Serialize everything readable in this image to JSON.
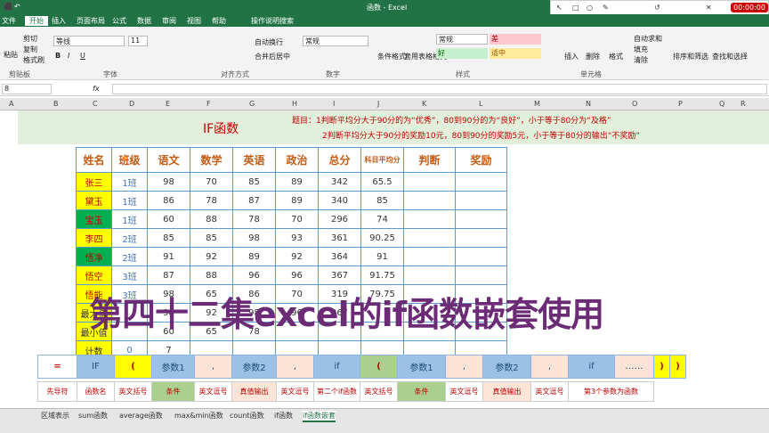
{
  "title": "函数 - Excel",
  "tabs": [
    "文件",
    "开始",
    "插入",
    "页面布局",
    "公式",
    "数据",
    "审阅",
    "视图",
    "帮助",
    "操作说明搜索"
  ],
  "groups": {
    "clipboard": "剪贴板",
    "font": "字体",
    "align": "对齐方式",
    "number": "数字",
    "styles": "样式",
    "cells": "单元格",
    "paste": "粘贴"
  },
  "font_name": "等线",
  "font_size": "11",
  "num_fmt": "常规",
  "btns": {
    "cut": "剪切",
    "copy": "复制",
    "painter": "格式刷",
    "wrap": "自动换行",
    "merge": "合并后居中",
    "cond": "条件格式",
    "table": "套用表格格式",
    "insert": "插入",
    "delete": "删除",
    "format": "格式",
    "autosum": "自动求和",
    "fill": "填充",
    "clear": "清除",
    "sort": "排序和筛选",
    "find": "查找和选择"
  },
  "styles_cells": [
    "常规",
    "差",
    "好",
    "适中"
  ],
  "cell_ref": "8",
  "fx": "fx",
  "timer": "00:00:00",
  "cols": [
    "A",
    "B",
    "C",
    "D",
    "E",
    "F",
    "G",
    "H",
    "I",
    "J",
    "K",
    "L",
    "M",
    "N",
    "O",
    "P",
    "Q",
    "R"
  ],
  "banner": {
    "func": "IF函数",
    "q1": "题目：1判断平均分大于90分的为“优秀”，80到90分的为“良好”，小于等于80分为“及格”",
    "q2": "2判断平均分大于90分的奖励10元，80到90分的奖励5元，小于等于80分的输出“不奖励”"
  },
  "headers": [
    "姓名",
    "班级",
    "语文",
    "数学",
    "英语",
    "政治",
    "总分",
    "科目平均分",
    "判断",
    "奖励"
  ],
  "rows": [
    [
      "张三",
      "1班",
      "98",
      "70",
      "85",
      "89",
      "342",
      "65.5"
    ],
    [
      "黛玉",
      "1班",
      "86",
      "78",
      "87",
      "89",
      "340",
      "85"
    ],
    [
      "宝玉",
      "1班",
      "60",
      "88",
      "78",
      "70",
      "296",
      "74"
    ],
    [
      "李四",
      "2班",
      "85",
      "85",
      "98",
      "93",
      "361",
      "90.25"
    ],
    [
      "悟净",
      "2班",
      "91",
      "92",
      "89",
      "92",
      "364",
      "91"
    ],
    [
      "悟空",
      "3班",
      "87",
      "88",
      "96",
      "96",
      "367",
      "91.75"
    ],
    [
      "悟能",
      "3班",
      "98",
      "65",
      "86",
      "70",
      "319",
      "79.75"
    ],
    [
      "最大值",
      "",
      "98",
      "92",
      "98",
      "96",
      "367",
      ""
    ],
    [
      "最小值",
      "",
      "60",
      "65",
      "78",
      "",
      "",
      ""
    ],
    [
      "计数",
      "0",
      "7",
      "",
      "",
      "",
      "",
      ""
    ]
  ],
  "overlay": "第四十二集excel的if函数嵌套使用",
  "formula": [
    "=",
    "IF",
    "(",
    "参数1",
    ",",
    "参数2",
    ",",
    "if",
    "(",
    "参数1",
    ",",
    "参数2",
    ",",
    "if",
    "……",
    ")",
    ")"
  ],
  "legend": [
    "先导符",
    "函数名",
    "英文括号",
    "条件",
    "英文逗号",
    "真值输出",
    "英文逗号",
    "第二个if函数",
    "英文括号",
    "条件",
    "英文逗号",
    "真值输出",
    "英文逗号",
    "第3个参数为函数"
  ],
  "sheets": [
    "区域表示",
    "sum函数",
    "average函数",
    "max&min函数",
    "count函数",
    "if函数",
    "if函数嵌套"
  ]
}
